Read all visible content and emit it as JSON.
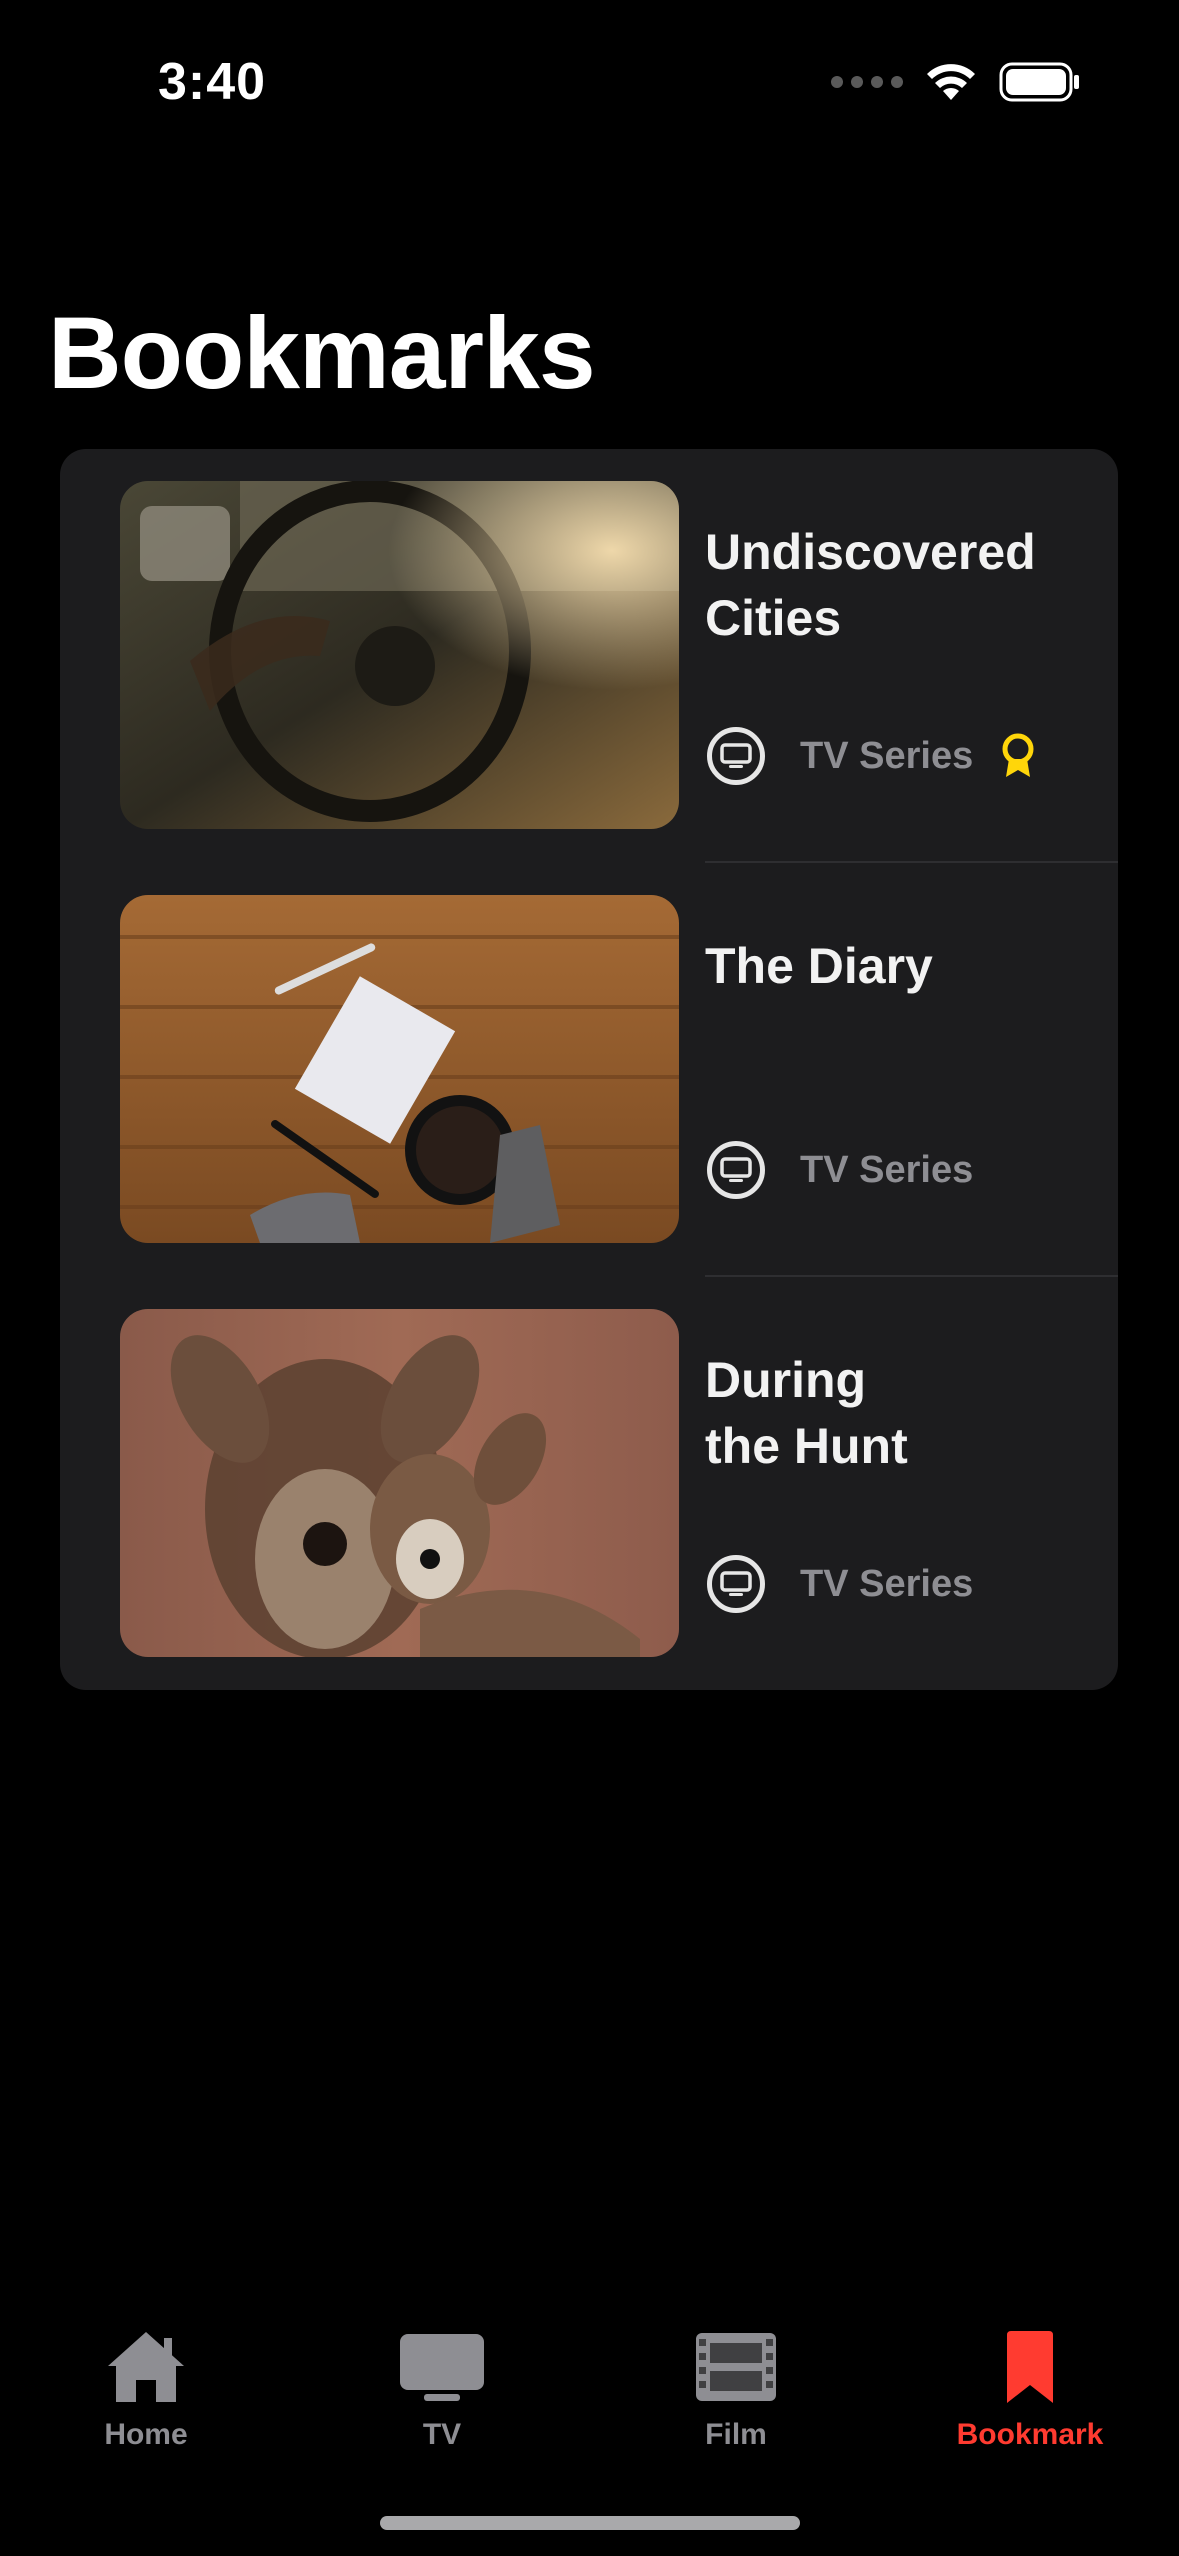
{
  "status_bar": {
    "time": "3:40"
  },
  "page": {
    "title": "Bookmarks"
  },
  "bookmarks": [
    {
      "title_line1": "Undiscovered",
      "title_line2": "Cities",
      "type": "TV Series",
      "type_icon": "tv-icon",
      "award": true
    },
    {
      "title_line1": "The Diary",
      "title_line2": "",
      "type": "TV Series",
      "type_icon": "tv-icon",
      "award": false
    },
    {
      "title_line1": "During",
      "title_line2": "the Hunt",
      "type": "TV Series",
      "type_icon": "tv-icon",
      "award": false
    }
  ],
  "tabbar": {
    "items": [
      {
        "label": "Home",
        "icon": "home-icon",
        "active": false
      },
      {
        "label": "TV",
        "icon": "tv-icon",
        "active": false
      },
      {
        "label": "Film",
        "icon": "film-icon",
        "active": false
      },
      {
        "label": "Bookmark",
        "icon": "bookmark-icon",
        "active": true
      }
    ]
  },
  "colors": {
    "background": "#000000",
    "card": "#1c1c1e",
    "accent": "#ff3b30",
    "award": "#ffd60a",
    "secondary_text": "#8e8e93"
  }
}
